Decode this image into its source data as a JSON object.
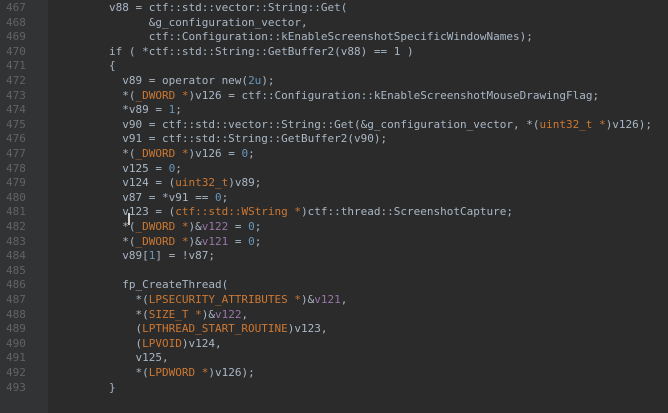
{
  "colors": {
    "background": "#2b2b2b",
    "gutter": "#313335",
    "line_number": "#606366",
    "plain": "#a9b7c6",
    "identifier": "#a9b7c6",
    "type": "#cc7832",
    "local_var": "#9876aa",
    "global": "#b389c5",
    "number": "#6897bb",
    "namespace": "#808080"
  },
  "editor": {
    "lines": [
      {
        "number": "467",
        "tokens": [
          {
            "t": "        v88 = ctf::std::vector::String::Get(",
            "c": "plain"
          }
        ]
      },
      {
        "number": "468",
        "tokens": [
          {
            "t": "              &g_configuration_vector,",
            "c": "plain"
          }
        ]
      },
      {
        "number": "469",
        "tokens": [
          {
            "t": "              ctf::Configuration::kEnableScreenshotSpecificWindowNames);",
            "c": "plain"
          }
        ]
      },
      {
        "number": "470",
        "tokens": [
          {
            "t": "        if ( *ctf::std::String::GetBuffer2(v88) == 1 )",
            "c": "plain"
          }
        ]
      },
      {
        "number": "471",
        "tokens": [
          {
            "t": "        {",
            "c": "plain"
          }
        ]
      },
      {
        "number": "472",
        "tokens": [
          {
            "t": "          v89 = operator new(",
            "c": "plain"
          },
          {
            "t": "2u",
            "c": "number"
          },
          {
            "t": ");",
            "c": "plain"
          }
        ]
      },
      {
        "number": "473",
        "tokens": [
          {
            "t": "          *(",
            "c": "plain"
          },
          {
            "t": "_DWORD *",
            "c": "type"
          },
          {
            "t": ")v126 = ctf::Configuration::kEnableScreenshotMouseDrawingFlag;",
            "c": "plain"
          }
        ]
      },
      {
        "number": "474",
        "tokens": [
          {
            "t": "          *v89 = ",
            "c": "plain"
          },
          {
            "t": "1",
            "c": "number"
          },
          {
            "t": ";",
            "c": "plain"
          }
        ]
      },
      {
        "number": "475",
        "tokens": [
          {
            "t": "          v90 = ctf::std::vector::String::Get(&g_configuration_vector, *(",
            "c": "plain"
          },
          {
            "t": "uint32_t *",
            "c": "type"
          },
          {
            "t": ")v126);",
            "c": "plain"
          }
        ]
      },
      {
        "number": "476",
        "tokens": [
          {
            "t": "          v91 = ctf::std::String::GetBuffer2(v90);",
            "c": "plain"
          }
        ]
      },
      {
        "number": "477",
        "tokens": [
          {
            "t": "          *(",
            "c": "plain"
          },
          {
            "t": "_DWORD *",
            "c": "type"
          },
          {
            "t": ")v126 = ",
            "c": "plain"
          },
          {
            "t": "0",
            "c": "number"
          },
          {
            "t": ";",
            "c": "plain"
          }
        ]
      },
      {
        "number": "478",
        "tokens": [
          {
            "t": "          v125 = ",
            "c": "plain"
          },
          {
            "t": "0",
            "c": "number"
          },
          {
            "t": ";",
            "c": "plain"
          }
        ]
      },
      {
        "number": "479",
        "tokens": [
          {
            "t": "          v124 = (",
            "c": "plain"
          },
          {
            "t": "uint32_t",
            "c": "type"
          },
          {
            "t": ")v89;",
            "c": "plain"
          }
        ]
      },
      {
        "number": "480",
        "tokens": [
          {
            "t": "          v87 = *v91 == ",
            "c": "plain"
          },
          {
            "t": "0",
            "c": "number"
          },
          {
            "t": ";",
            "c": "plain"
          }
        ]
      },
      {
        "number": "481",
        "tokens": [
          {
            "t": "          v123 = (",
            "c": "plain"
          },
          {
            "t": "ctf::std::WString *",
            "c": "type"
          },
          {
            "t": ")ctf::thread::ScreenshotCapture;",
            "c": "plain"
          }
        ]
      },
      {
        "number": "482",
        "tokens": [
          {
            "t": "          *(",
            "c": "plain"
          },
          {
            "t": "_DWORD *",
            "c": "type"
          },
          {
            "t": ")&",
            "c": "plain"
          },
          {
            "t": "v122",
            "c": "local_var"
          },
          {
            "t": " = ",
            "c": "plain"
          },
          {
            "t": "0",
            "c": "number"
          },
          {
            "t": ";",
            "c": "plain"
          }
        ]
      },
      {
        "number": "483",
        "tokens": [
          {
            "t": "          *(",
            "c": "plain"
          },
          {
            "t": "_DWORD *",
            "c": "type"
          },
          {
            "t": ")&",
            "c": "plain"
          },
          {
            "t": "v121",
            "c": "local_var"
          },
          {
            "t": " = ",
            "c": "plain"
          },
          {
            "t": "0",
            "c": "number"
          },
          {
            "t": ";",
            "c": "plain"
          }
        ]
      },
      {
        "number": "484",
        "tokens": [
          {
            "t": "          v89[",
            "c": "plain"
          },
          {
            "t": "1",
            "c": "number"
          },
          {
            "t": "] = !v87;",
            "c": "plain"
          }
        ]
      },
      {
        "number": "485",
        "tokens": []
      },
      {
        "number": "486",
        "tokens": [
          {
            "t": "          fp_CreateThread(",
            "c": "plain"
          }
        ]
      },
      {
        "number": "487",
        "tokens": [
          {
            "t": "            *(",
            "c": "plain"
          },
          {
            "t": "LPSECURITY_ATTRIBUTES *",
            "c": "type"
          },
          {
            "t": ")&",
            "c": "plain"
          },
          {
            "t": "v121",
            "c": "local_var"
          },
          {
            "t": ",",
            "c": "plain"
          }
        ]
      },
      {
        "number": "488",
        "tokens": [
          {
            "t": "            *(",
            "c": "plain"
          },
          {
            "t": "SIZE_T *",
            "c": "type"
          },
          {
            "t": ")&",
            "c": "plain"
          },
          {
            "t": "v122",
            "c": "local_var"
          },
          {
            "t": ",",
            "c": "plain"
          }
        ]
      },
      {
        "number": "489",
        "tokens": [
          {
            "t": "            (",
            "c": "plain"
          },
          {
            "t": "LPTHREAD_START_ROUTINE",
            "c": "type"
          },
          {
            "t": ")v123,",
            "c": "plain"
          }
        ]
      },
      {
        "number": "490",
        "tokens": [
          {
            "t": "            (",
            "c": "plain"
          },
          {
            "t": "LPVOID",
            "c": "type"
          },
          {
            "t": ")v124,",
            "c": "plain"
          }
        ]
      },
      {
        "number": "491",
        "tokens": [
          {
            "t": "            v125,",
            "c": "plain"
          }
        ]
      },
      {
        "number": "492",
        "tokens": [
          {
            "t": "            *(",
            "c": "plain"
          },
          {
            "t": "LPDWORD *",
            "c": "type"
          },
          {
            "t": ")v126);",
            "c": "plain"
          }
        ]
      },
      {
        "number": "493",
        "tokens": [
          {
            "t": "        }",
            "c": "plain"
          }
        ]
      }
    ]
  }
}
